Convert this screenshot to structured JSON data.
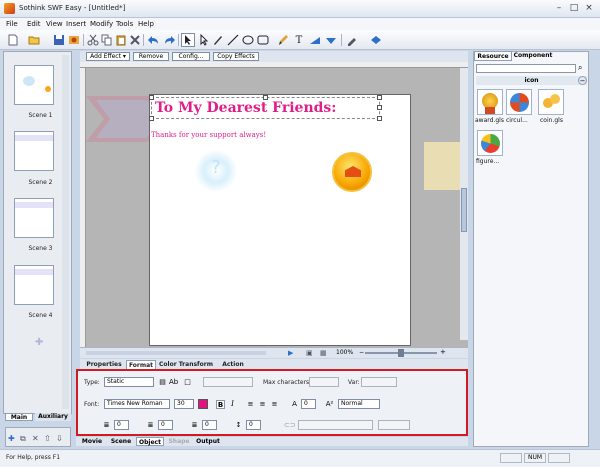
{
  "window": {
    "title": "Sothink SWF Easy - [Untitled*]",
    "min_label": "–",
    "max_label": "□",
    "close_label": "×"
  },
  "menu": [
    "File",
    "Edit",
    "View",
    "Insert",
    "Modify",
    "Tools",
    "Help"
  ],
  "toolbar": {
    "icons": [
      "new-icon",
      "open-icon",
      "save-icon",
      "publish-icon",
      "cut-icon",
      "copy-icon",
      "paste-icon",
      "delete-icon",
      "undo-icon",
      "redo-icon",
      "select-icon",
      "subselect-icon",
      "pen-icon",
      "line-icon",
      "oval-icon",
      "rect-icon",
      "brush-icon",
      "text-icon",
      "transform-icon",
      "paint-icon",
      "eyedropper-icon",
      "fill-icon"
    ]
  },
  "scenes": {
    "items": [
      {
        "label": "Scene 1"
      },
      {
        "label": "Scene 2"
      },
      {
        "label": "Scene 3"
      },
      {
        "label": "Scene 4"
      }
    ],
    "tabs": [
      "Main",
      "Auxiliary"
    ]
  },
  "effectbar": {
    "add_effect": "Add Effect ▾",
    "remove": "Remove",
    "config": "Config...",
    "copy_effects": "Copy Effects"
  },
  "stage": {
    "heading": "To My Dearest Friends:",
    "subtext": "Thanks for your support always!",
    "zoom": "100%"
  },
  "properties": {
    "tabs": [
      "Properties",
      "Format",
      "Color Transform",
      "Action"
    ],
    "active_tab": "Format",
    "type_label": "Type:",
    "type_value": "Static",
    "max_chars_label": "Max characters:",
    "var_label": "Var:",
    "font_label": "Font:",
    "font_value": "Times New Roman",
    "size_value": "30",
    "bold": "B",
    "italic": "I",
    "spacing_value": "0",
    "baseline_value": "Normal",
    "indent_value": "0",
    "left_margin_value": "0",
    "right_margin_value": "0",
    "line_spacing_value": "0",
    "text_color": "#e0147f"
  },
  "bottom_tabs": [
    "Movie",
    "Scene",
    "Object",
    "Shape",
    "Output"
  ],
  "bottom_active": "Object",
  "resource": {
    "tabs": [
      "Resource",
      "Component"
    ],
    "group": "icon",
    "items": [
      {
        "label": "award.gls"
      },
      {
        "label": "circul..."
      },
      {
        "label": "coin.gls"
      },
      {
        "label": "figure..."
      }
    ]
  },
  "status": {
    "text": "For Help, press F1",
    "mode": "NUM"
  },
  "colors": {
    "accent_red": "#d01a24",
    "heading_pink": "#e01e89",
    "panel_bg": "#c9d6e8"
  }
}
